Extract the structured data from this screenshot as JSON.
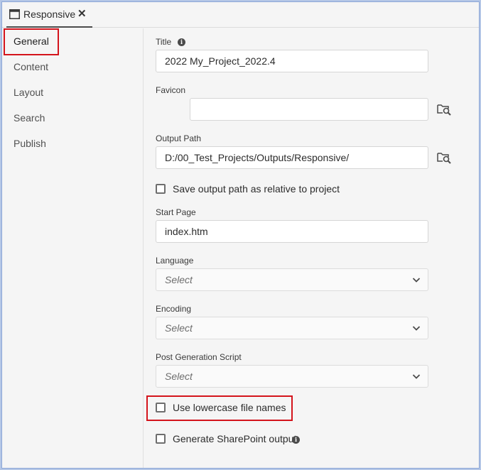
{
  "tab": {
    "label": "Responsive",
    "close_glyph": "✕",
    "icon": "window-icon"
  },
  "sidebar": {
    "items": [
      {
        "label": "General",
        "active": true
      },
      {
        "label": "Content",
        "active": false
      },
      {
        "label": "Layout",
        "active": false
      },
      {
        "label": "Search",
        "active": false
      },
      {
        "label": "Publish",
        "active": false
      }
    ]
  },
  "form": {
    "title": {
      "label": "Title",
      "value": "2022 My_Project_2022.4",
      "info_glyph": "i"
    },
    "favicon": {
      "label": "Favicon",
      "value": "",
      "browse_icon": "folder-search-icon"
    },
    "output_path": {
      "label": "Output Path",
      "value": "D:/00_Test_Projects/Outputs/Responsive/",
      "browse_icon": "folder-search-icon"
    },
    "relative_path": {
      "label": "Save output path as relative to project",
      "checked": false
    },
    "start_page": {
      "label": "Start Page",
      "value": "index.htm"
    },
    "language": {
      "label": "Language",
      "value": "Select"
    },
    "encoding": {
      "label": "Encoding",
      "value": "Select"
    },
    "post_script": {
      "label": "Post Generation Script",
      "value": "Select"
    },
    "lowercase": {
      "label": "Use lowercase file names",
      "checked": false
    },
    "sharepoint": {
      "label": "Generate SharePoint output",
      "checked": false,
      "info_glyph": "i"
    }
  },
  "colors": {
    "highlight": "#d4141c",
    "frame": "#b4c6e6",
    "panel": "#f5f5f5"
  }
}
